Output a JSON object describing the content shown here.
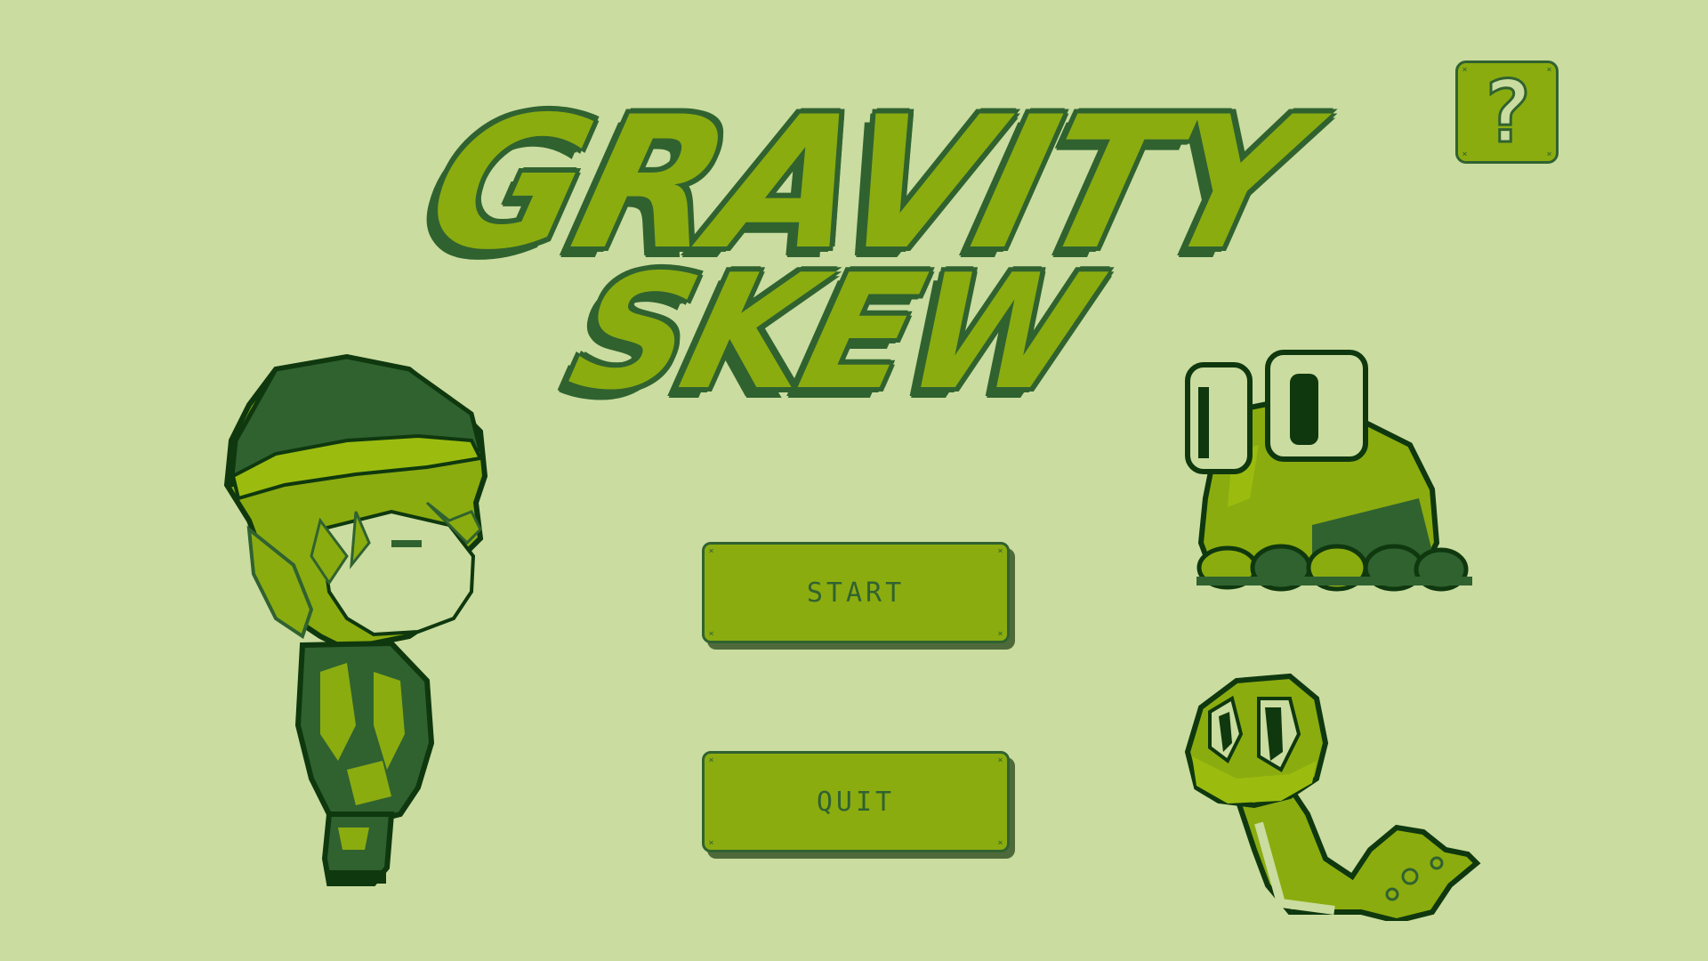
{
  "game": {
    "title_line1": "GRAVITY",
    "title_line2": "SKEW"
  },
  "menu": {
    "start_label": "START",
    "quit_label": "QUIT"
  },
  "help": {
    "label": "?"
  },
  "palette": {
    "background": "#cadc9f",
    "light": "#8bac0f",
    "dark": "#306230",
    "darkest": "#0f380f",
    "shadow": "#4f6a3a"
  },
  "characters": {
    "player": "boy-with-headband-sprite",
    "enemy_top": "frog-blob-sprite",
    "enemy_bottom": "snake-sprite"
  }
}
